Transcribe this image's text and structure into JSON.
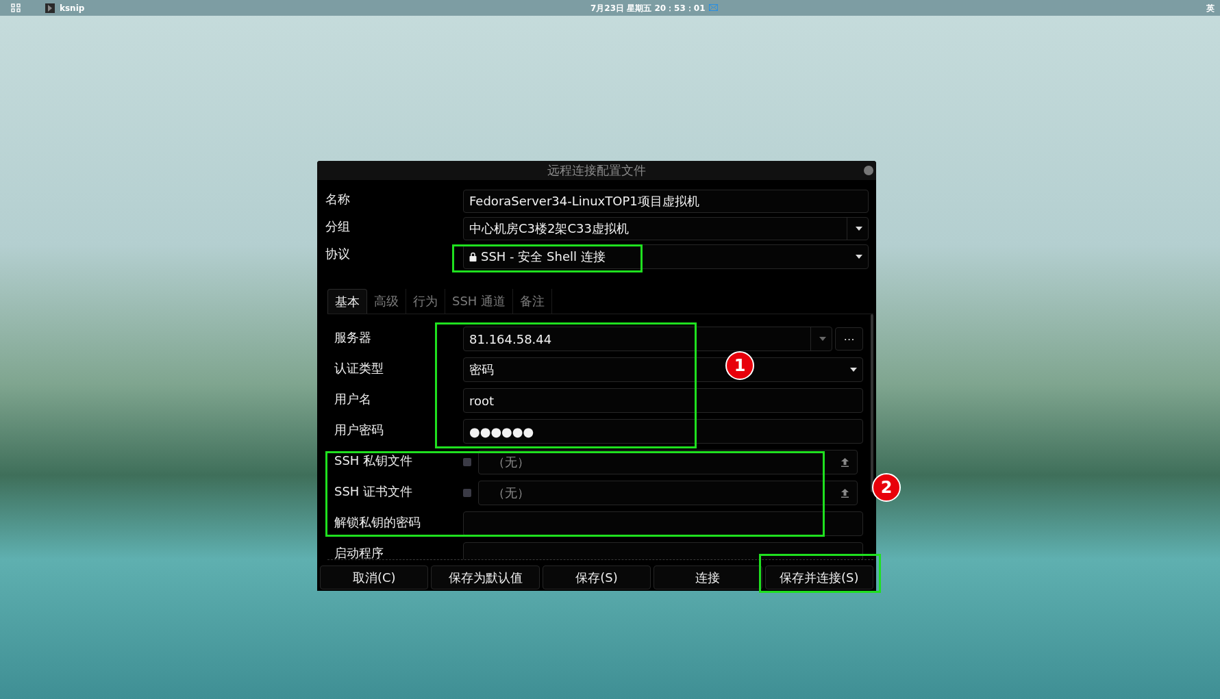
{
  "top_bar": {
    "app": "ksnip",
    "clock": "7月23日 星期五 20：53：01",
    "input_method": "英"
  },
  "dialog": {
    "title": "远程连接配置文件",
    "fields": [
      {
        "label": "名称",
        "kind": "text",
        "value": "FedoraServer34-LinuxTOP1项目虚拟机"
      },
      {
        "label": "分组",
        "kind": "dropdown",
        "value": "中心机房C3楼2架C33虚拟机"
      },
      {
        "label": "协议",
        "kind": "protocol",
        "value": "SSH - 安全 Shell 连接"
      }
    ],
    "tabs": [
      {
        "label": "基本",
        "selected": true
      },
      {
        "label": "高级",
        "selected": false
      },
      {
        "label": "行为",
        "selected": false
      },
      {
        "label": "SSH 通道",
        "selected": false
      },
      {
        "label": "备注",
        "selected": false
      }
    ],
    "tab_fields": [
      {
        "label": "服务器",
        "kind": "server",
        "value": "81.164.58.44",
        "more_button": "⋯"
      },
      {
        "label": "认证类型",
        "kind": "dropdown",
        "value": "密码"
      },
      {
        "label": "用户名",
        "kind": "text",
        "value": "root"
      },
      {
        "label": "用户密码",
        "kind": "password",
        "value": "●●●●●●"
      },
      {
        "label": "SSH 私钥文件",
        "kind": "file",
        "checked": false,
        "disabled": true,
        "value": "（无）"
      },
      {
        "label": "SSH 证书文件",
        "kind": "file",
        "checked": false,
        "disabled": true,
        "value": "（无）"
      },
      {
        "label": "解锁私钥的密码",
        "kind": "text"
      },
      {
        "label": "启动程序",
        "kind": "text"
      }
    ],
    "buttons": [
      "取消(C)",
      "保存为默认值",
      "保存(S)",
      "连接",
      "保存并连接(S)"
    ]
  },
  "annotations": [
    {
      "label": "1"
    },
    {
      "label": "2"
    }
  ]
}
